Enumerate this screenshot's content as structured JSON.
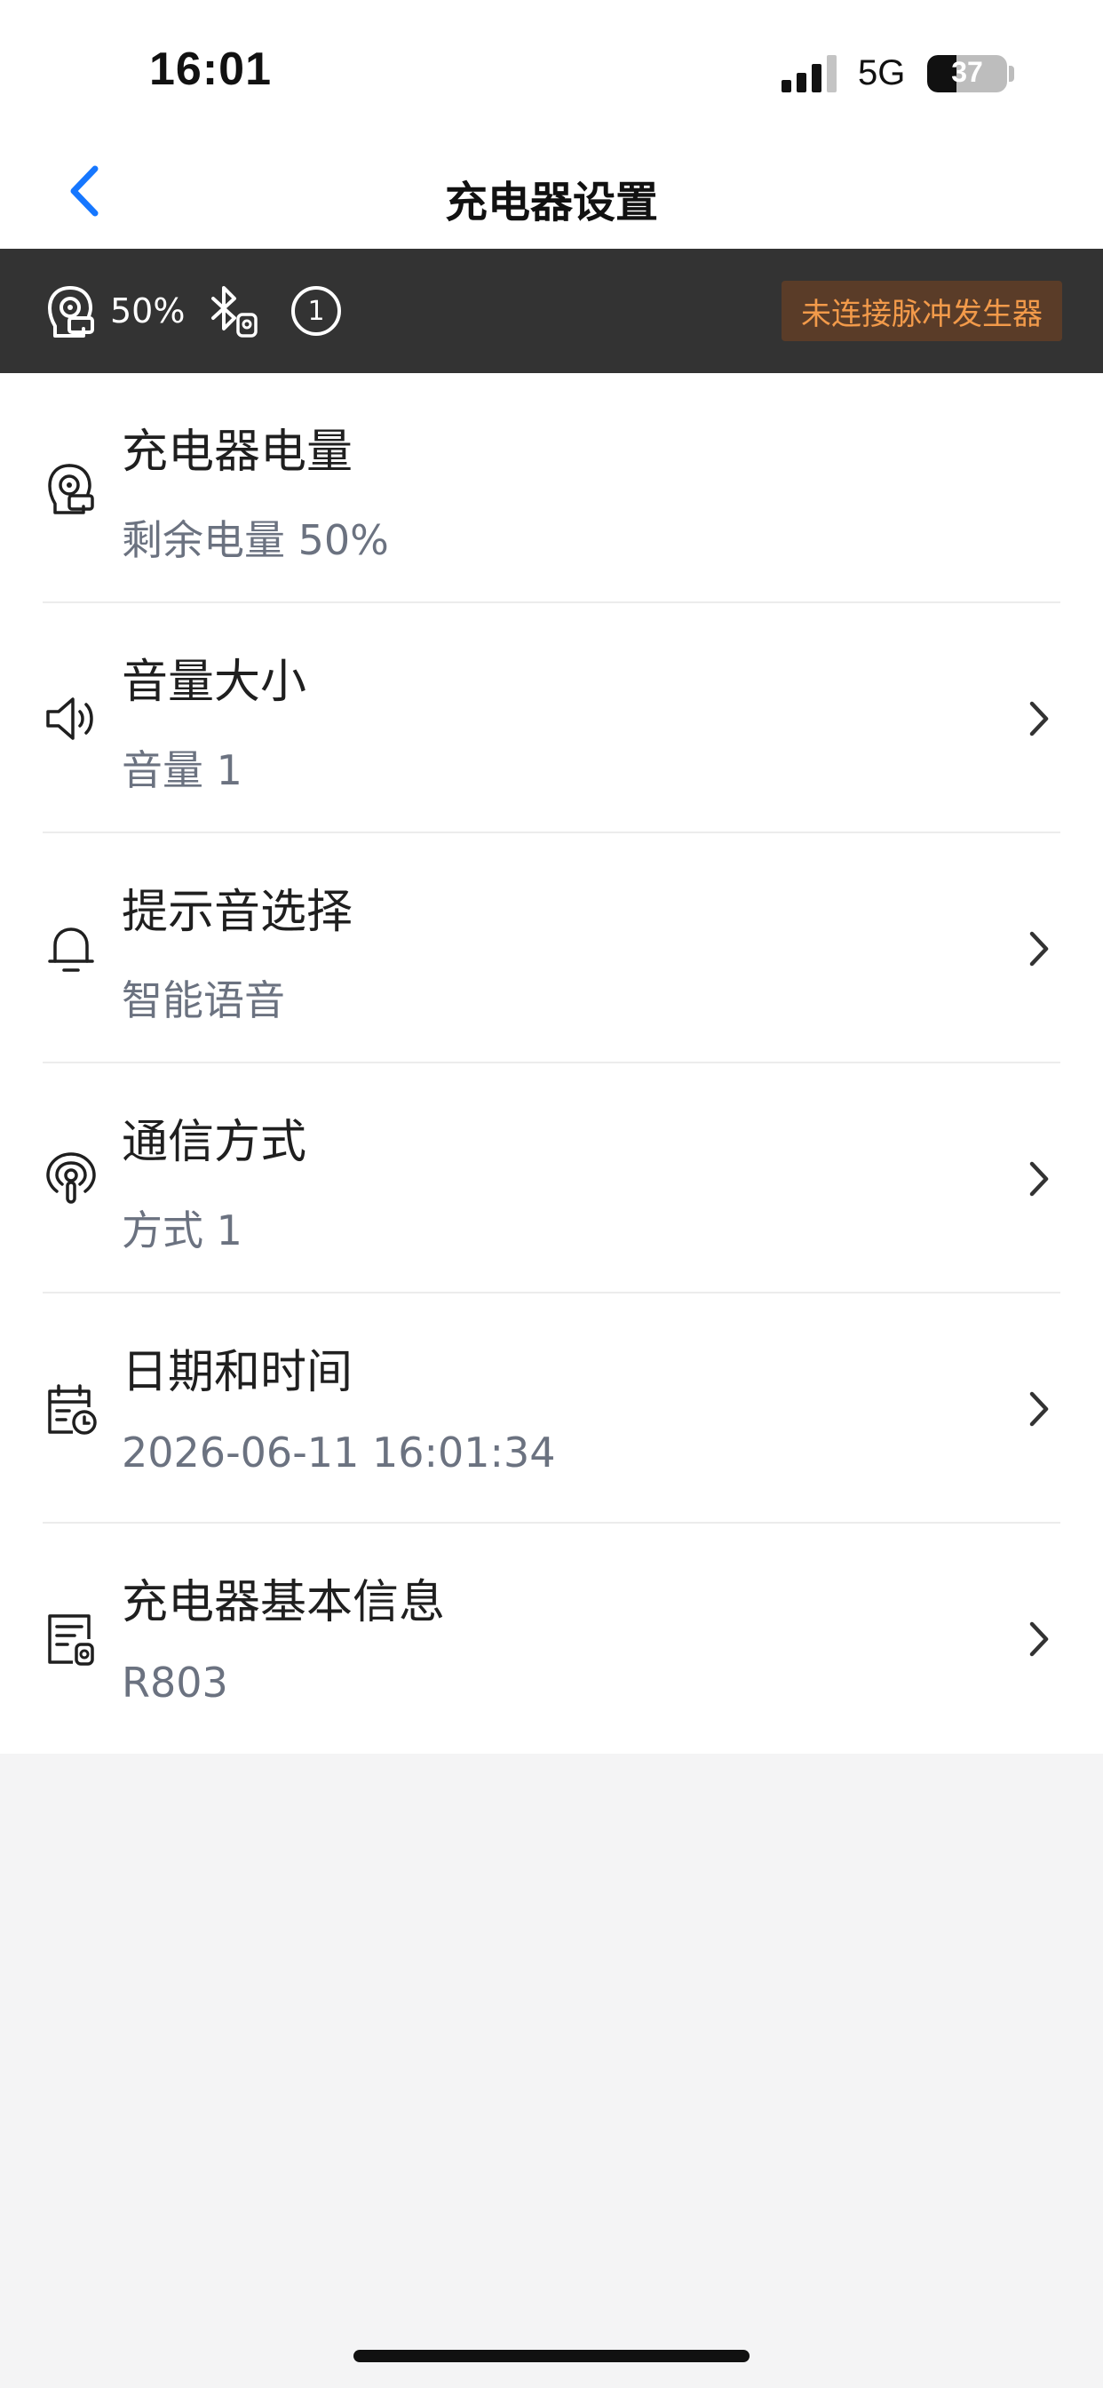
{
  "status_bar": {
    "time": "16:01",
    "network": "5G",
    "battery_level": "37",
    "battery_fraction": 0.37
  },
  "nav": {
    "title": "充电器设置",
    "back_icon": "chevron-left-icon"
  },
  "device_bar": {
    "battery_pct": "50%",
    "channel_number": "1",
    "warning": "未连接脉冲发生器"
  },
  "list": {
    "items": [
      {
        "title": "充电器电量",
        "subtitle": "剩余电量 50%",
        "icon": "charger-icon",
        "has_chevron": false
      },
      {
        "title": "音量大小",
        "subtitle": "音量 1",
        "icon": "speaker-icon",
        "has_chevron": true
      },
      {
        "title": "提示音选择",
        "subtitle": "智能语音",
        "icon": "bell-icon",
        "has_chevron": true
      },
      {
        "title": "通信方式",
        "subtitle": "方式 1",
        "icon": "antenna-icon",
        "has_chevron": true
      },
      {
        "title": "日期和时间",
        "subtitle": "2026-06-11 16:01:34",
        "icon": "calendar-clock-icon",
        "has_chevron": true
      },
      {
        "title": "充电器基本信息",
        "subtitle": "R803",
        "icon": "device-info-icon",
        "has_chevron": true
      }
    ]
  },
  "colors": {
    "accent": "#1677ff",
    "device_bar_bg": "#333333",
    "warning_text": "#f29a4a",
    "warning_bg": "#5a3c28",
    "subtitle": "#6b7280"
  }
}
